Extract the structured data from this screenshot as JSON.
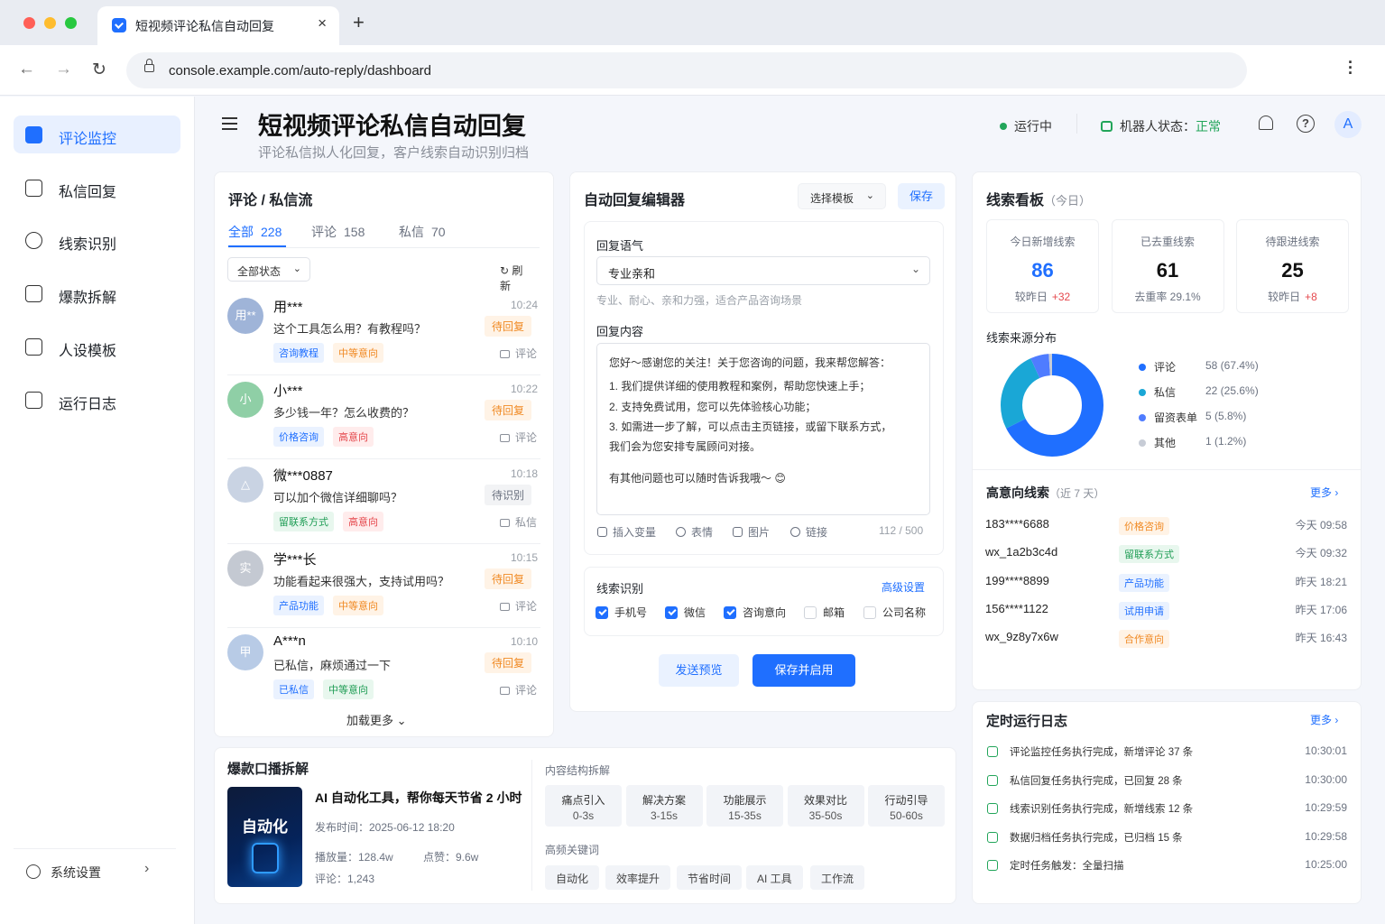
{
  "browser": {
    "tab_title": "短视频评论私信自动回复",
    "url": "console.example.com/auto-reply/dashboard"
  },
  "sidebar": {
    "items": [
      {
        "label": "评论监控",
        "icon": "shield-check-icon",
        "active": true
      },
      {
        "label": "私信回复",
        "icon": "chat-icon"
      },
      {
        "label": "线索识别",
        "icon": "target-icon"
      },
      {
        "label": "爆款拆解",
        "icon": "puzzle-icon"
      },
      {
        "label": "人设模板",
        "icon": "persona-icon"
      },
      {
        "label": "运行日志",
        "icon": "document-icon"
      }
    ],
    "settings_label": "系统设置"
  },
  "header": {
    "title": "短视频评论私信自动回复",
    "subtitle": "评论私信拟人化回复，客户线索自动识别归档",
    "run_status": "运行中",
    "bot_status_label": "机器人状态：",
    "bot_status_value": "正常",
    "avatar": "A"
  },
  "stream": {
    "title": "评论 / 私信流",
    "tabs": [
      {
        "label": "全部",
        "count": "228"
      },
      {
        "label": "评论",
        "count": "158"
      },
      {
        "label": "私信",
        "count": "70"
      }
    ],
    "filter": "全部状态",
    "refresh": "刷新",
    "load_more": "加载更多",
    "items": [
      {
        "avatar": "用**",
        "name": "用***",
        "time": "10:24",
        "text": "这个工具怎么用？有教程吗？",
        "status": "待回复",
        "status_color": "org",
        "tags": [
          {
            "t": "咨询教程",
            "c": "blue"
          },
          {
            "t": "中等意向",
            "c": "org"
          }
        ],
        "source": "评论",
        "avatar_color": "#9fb4d8"
      },
      {
        "avatar": "小",
        "name": "小***",
        "time": "10:22",
        "text": "多少钱一年？怎么收费的？",
        "status": "待回复",
        "status_color": "org",
        "tags": [
          {
            "t": "价格咨询",
            "c": "blue"
          },
          {
            "t": "高意向",
            "c": "red"
          }
        ],
        "source": "评论",
        "avatar_color": "#8fcfa6"
      },
      {
        "avatar": "△",
        "name": "微***0887",
        "time": "10:18",
        "text": "可以加个微信详细聊吗？",
        "status": "待识别",
        "status_color": "gray",
        "tags": [
          {
            "t": "留联系方式",
            "c": "green"
          },
          {
            "t": "高意向",
            "c": "red"
          }
        ],
        "source": "私信",
        "avatar_color": "#c9d3e3"
      },
      {
        "avatar": "实",
        "name": "学***长",
        "time": "10:15",
        "text": "功能看起来很强大，支持试用吗？",
        "status": "待回复",
        "status_color": "org",
        "tags": [
          {
            "t": "产品功能",
            "c": "blue"
          },
          {
            "t": "中等意向",
            "c": "org"
          }
        ],
        "source": "评论",
        "avatar_color": "#c4c9d2"
      },
      {
        "avatar": "甲",
        "name": "A***n",
        "time": "10:10",
        "text": "已私信，麻烦通过一下",
        "status": "待回复",
        "status_color": "org",
        "tags": [
          {
            "t": "已私信",
            "c": "blue"
          },
          {
            "t": "中等意向",
            "c": "green"
          }
        ],
        "source": "评论",
        "avatar_color": "#b8cbe6"
      }
    ]
  },
  "editor": {
    "title": "自动回复编辑器",
    "template_btn": "选择模板",
    "save_btn": "保存",
    "tone_label": "回复语气",
    "tone_value": "专业亲和",
    "tone_hint": "专业、耐心、亲和力强，适合产品咨询场景",
    "content_label": "回复内容",
    "content_lines": [
      "您好～感谢您的关注！关于您咨询的问题，我来帮您解答：",
      "1. 我们提供详细的使用教程和案例，帮助您快速上手；",
      "2. 支持免费试用，您可以先体验核心功能；",
      "3. 如需进一步了解，可以点击主页链接，或留下联系方式，",
      "我们会为您安排专属顾问对接。",
      "有其他问题也可以随时告诉我哦～ 😊"
    ],
    "toolbar": {
      "var": "插入变量",
      "emoji": "表情",
      "image": "图片",
      "link": "链接",
      "count": "112 / 500"
    },
    "lead_title": "线索识别",
    "advanced": "高级设置",
    "checks": [
      {
        "label": "手机号",
        "on": true
      },
      {
        "label": "微信",
        "on": true
      },
      {
        "label": "咨询意向",
        "on": true
      },
      {
        "label": "邮箱",
        "on": false
      },
      {
        "label": "公司名称",
        "on": false
      }
    ],
    "preview_btn": "发送预览",
    "enable_btn": "保存并启用"
  },
  "leads": {
    "title": "线索看板",
    "scope": "（今日）",
    "stats": [
      {
        "label": "今日新增线索",
        "value": "86",
        "delta_label": "较昨日",
        "delta": "+32",
        "accent": true
      },
      {
        "label": "已去重线索",
        "value": "61",
        "delta_label": "去重率 29.1%",
        "delta": ""
      },
      {
        "label": "待跟进线索",
        "value": "25",
        "delta_label": "较昨日",
        "delta": "+8"
      }
    ],
    "source_title": "线索来源分布",
    "sources": [
      {
        "name": "评论",
        "value": "58 (67.4%)",
        "pct": 67.4,
        "color": "#1f6fff"
      },
      {
        "name": "私信",
        "value": "22 (25.6%)",
        "pct": 25.6,
        "color": "#1aa7d6"
      },
      {
        "name": "留资表单",
        "value": "5 (5.8%)",
        "pct": 5.8,
        "color": "#4f7cff"
      },
      {
        "name": "其他",
        "value": "1 (1.2%)",
        "pct": 1.2,
        "color": "#c7ccd6"
      }
    ],
    "high_title": "高意向线索",
    "high_scope": "（近 7 天）",
    "more": "更多",
    "high": [
      {
        "id": "183****6688",
        "tag": "价格咨询",
        "c": "org",
        "time": "今天  09:58"
      },
      {
        "id": "wx_1a2b3c4d",
        "tag": "留联系方式",
        "c": "green",
        "time": "今天  09:32"
      },
      {
        "id": "199****8899",
        "tag": "产品功能",
        "c": "blue",
        "time": "昨天  18:21"
      },
      {
        "id": "156****1122",
        "tag": "试用申请",
        "c": "blue",
        "time": "昨天  17:06"
      },
      {
        "id": "wx_9z8y7x6w",
        "tag": "合作意向",
        "c": "org",
        "time": "昨天  16:43"
      }
    ]
  },
  "logs": {
    "title": "定时运行日志",
    "more": "更多",
    "items": [
      {
        "text": "评论监控任务执行完成，新增评论 37 条",
        "time": "10:30:01"
      },
      {
        "text": "私信回复任务执行完成，已回复 28 条",
        "time": "10:30:00"
      },
      {
        "text": "线索识别任务执行完成，新增线索 12 条",
        "time": "10:29:59"
      },
      {
        "text": "数据归档任务执行完成，已归档 15 条",
        "time": "10:29:58"
      },
      {
        "text": "定时任务触发：全量扫描",
        "time": "10:25:00"
      }
    ]
  },
  "viral": {
    "title": "爆款口播拆解",
    "thumb_text": "自动化",
    "video_title": "AI 自动化工具，帮你每天节省 2 小时",
    "publish": "发布时间：2025-06-12 18:20",
    "plays": "播放量：128.4w",
    "likes": "点赞：9.6w",
    "comments": "评论：1,243",
    "structure_title": "内容结构拆解",
    "segments": [
      {
        "name": "痛点引入",
        "time": "0-3s"
      },
      {
        "name": "解决方案",
        "time": "3-15s"
      },
      {
        "name": "功能展示",
        "time": "15-35s"
      },
      {
        "name": "效果对比",
        "time": "35-50s"
      },
      {
        "name": "行动引导",
        "time": "50-60s"
      }
    ],
    "kw_title": "高频关键词",
    "keywords": [
      "自动化",
      "效率提升",
      "节省时间",
      "AI 工具",
      "工作流"
    ]
  }
}
